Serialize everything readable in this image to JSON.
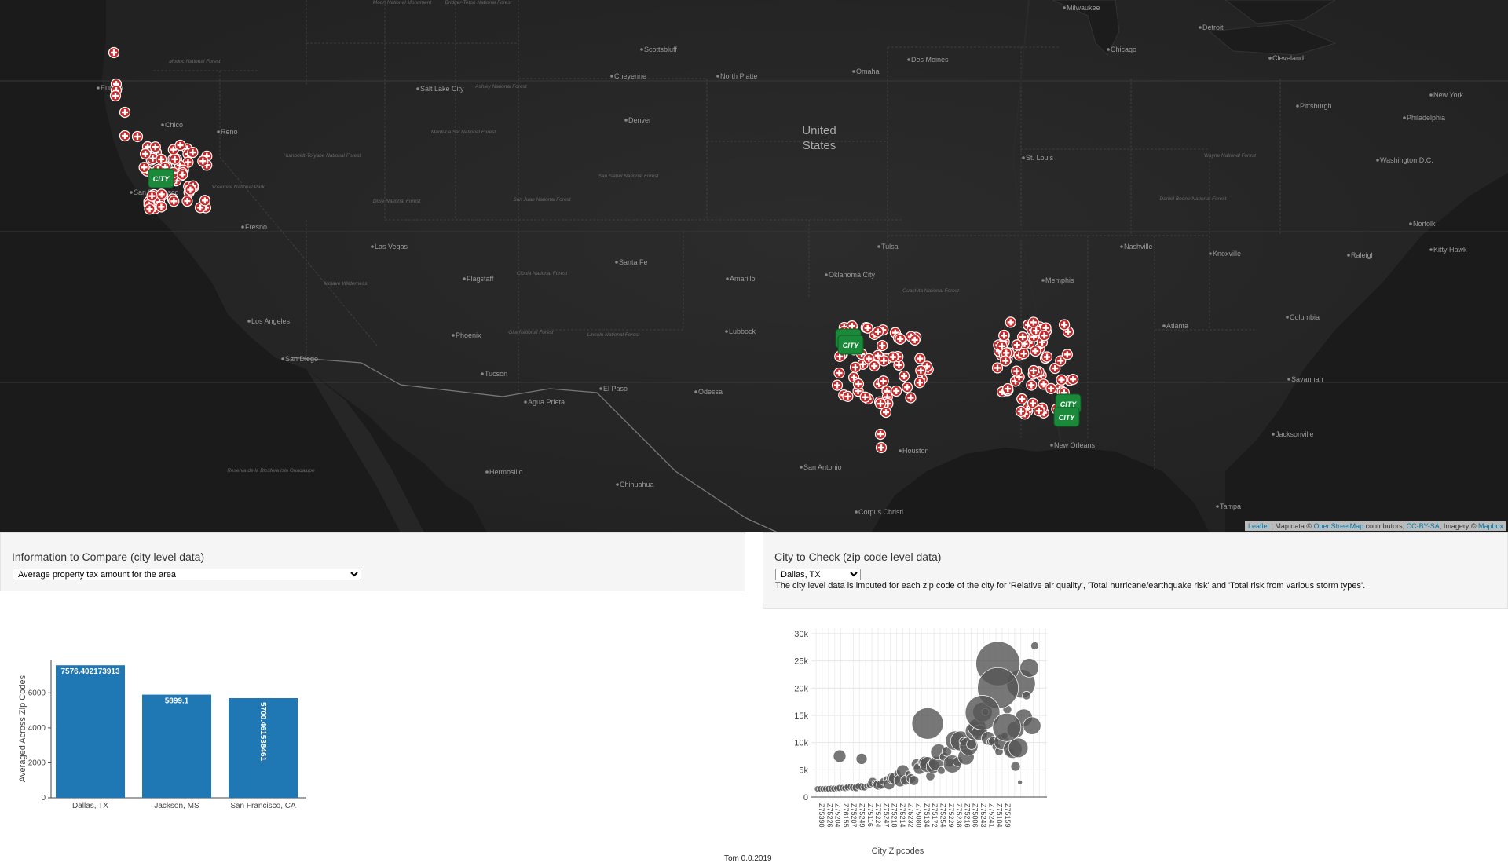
{
  "map": {
    "country_label": [
      "United",
      "States"
    ],
    "cities": [
      {
        "name": "Milwaukee",
        "x": 1358,
        "y": 10
      },
      {
        "name": "Detroit",
        "x": 1531,
        "y": 35
      },
      {
        "name": "Chicago",
        "x": 1414,
        "y": 63
      },
      {
        "name": "Cleveland",
        "x": 1620,
        "y": 74
      },
      {
        "name": "New York",
        "x": 1825,
        "y": 121
      },
      {
        "name": "Scottsbluff",
        "x": 820,
        "y": 63
      },
      {
        "name": "Cheyenne",
        "x": 782,
        "y": 97
      },
      {
        "name": "North Platte",
        "x": 917,
        "y": 97
      },
      {
        "name": "Omaha",
        "x": 1090,
        "y": 91
      },
      {
        "name": "Des Moines",
        "x": 1160,
        "y": 76
      },
      {
        "name": "Pittsburgh",
        "x": 1655,
        "y": 135
      },
      {
        "name": "Philadelphia",
        "x": 1791,
        "y": 150
      },
      {
        "name": "Washington D.C.",
        "x": 1757,
        "y": 204
      },
      {
        "name": "Norfolk",
        "x": 1799,
        "y": 285
      },
      {
        "name": "Eureka",
        "x": 128,
        "y": 112
      },
      {
        "name": "Salt Lake City",
        "x": 535,
        "y": 113
      },
      {
        "name": "Denver",
        "x": 800,
        "y": 153
      },
      {
        "name": "Chico",
        "x": 210,
        "y": 159
      },
      {
        "name": "Reno",
        "x": 281,
        "y": 168
      },
      {
        "name": "San Francisco",
        "x": 170,
        "y": 245
      },
      {
        "name": "Fresno",
        "x": 312,
        "y": 289
      },
      {
        "name": "Las Vegas",
        "x": 477,
        "y": 314
      },
      {
        "name": "Flagstaff",
        "x": 594,
        "y": 355
      },
      {
        "name": "Santa Fe",
        "x": 788,
        "y": 334
      },
      {
        "name": "Amarillo",
        "x": 929,
        "y": 355
      },
      {
        "name": "Oklahoma City",
        "x": 1055,
        "y": 350
      },
      {
        "name": "Tulsa",
        "x": 1122,
        "y": 314
      },
      {
        "name": "Memphis",
        "x": 1331,
        "y": 357
      },
      {
        "name": "Nashville",
        "x": 1431,
        "y": 314
      },
      {
        "name": "Knoxville",
        "x": 1544,
        "y": 323
      },
      {
        "name": "Raleigh",
        "x": 1720,
        "y": 325
      },
      {
        "name": "Kitty Hawk",
        "x": 1825,
        "y": 318
      },
      {
        "name": "St. Louis",
        "x": 1306,
        "y": 201
      },
      {
        "name": "Los Angeles",
        "x": 320,
        "y": 409
      },
      {
        "name": "Phoenix",
        "x": 580,
        "y": 427
      },
      {
        "name": "San Diego",
        "x": 363,
        "y": 457
      },
      {
        "name": "Lubbock",
        "x": 928,
        "y": 422
      },
      {
        "name": "Tucson",
        "x": 617,
        "y": 476
      },
      {
        "name": "El Paso",
        "x": 768,
        "y": 495
      },
      {
        "name": "Odessa",
        "x": 889,
        "y": 499
      },
      {
        "name": "Agua Prieta",
        "x": 672,
        "y": 512
      },
      {
        "name": "Columbia",
        "x": 1642,
        "y": 404
      },
      {
        "name": "Atlanta",
        "x": 1485,
        "y": 415
      },
      {
        "name": "Savannah",
        "x": 1644,
        "y": 483
      },
      {
        "name": "Jacksonville",
        "x": 1624,
        "y": 553
      },
      {
        "name": "Houston",
        "x": 1149,
        "y": 574
      },
      {
        "name": "New Orleans",
        "x": 1342,
        "y": 567
      },
      {
        "name": "San Antonio",
        "x": 1023,
        "y": 595
      },
      {
        "name": "Hermosillo",
        "x": 623,
        "y": 601
      },
      {
        "name": "Chihuahua",
        "x": 789,
        "y": 617
      },
      {
        "name": "Corpus Christi",
        "x": 1093,
        "y": 652
      },
      {
        "name": "Tampa",
        "x": 1553,
        "y": 645
      }
    ],
    "forests": [
      {
        "name": "Modoc National Forest",
        "x": 248,
        "y": 80
      },
      {
        "name": "Humboldt-Toiyabe National Forest",
        "x": 410,
        "y": 200
      },
      {
        "name": "Ashley National Forest",
        "x": 638,
        "y": 112
      },
      {
        "name": "Manti-La Sal National Forest",
        "x": 590,
        "y": 170
      },
      {
        "name": "Dixie National Forest",
        "x": 505,
        "y": 258
      },
      {
        "name": "San Juan National Forest",
        "x": 690,
        "y": 256
      },
      {
        "name": "San Isabel National Forest",
        "x": 800,
        "y": 226
      },
      {
        "name": "Yosemite National Park",
        "x": 303,
        "y": 240
      },
      {
        "name": "Mojave Wilderness",
        "x": 440,
        "y": 363
      },
      {
        "name": "Cibola National Forest",
        "x": 690,
        "y": 350
      },
      {
        "name": "Gila National Forest",
        "x": 676,
        "y": 425
      },
      {
        "name": "Lincoln National Forest",
        "x": 781,
        "y": 428
      },
      {
        "name": "Ouachita National Forest",
        "x": 1185,
        "y": 372
      },
      {
        "name": "Wayne National Forest",
        "x": 1566,
        "y": 200
      },
      {
        "name": "Daniel Boone National Forest",
        "x": 1519,
        "y": 255
      },
      {
        "name": "Moon National Monument",
        "x": 512,
        "y": 5
      },
      {
        "name": "Bridger-Teton National Forest",
        "x": 609,
        "y": 5
      },
      {
        "name": "Reserva de la Biosfera Isla Guadalupe",
        "x": 345,
        "y": 601
      }
    ],
    "attribution": {
      "leaflet": "Leaflet",
      "sep": " | Map data © ",
      "osm": "OpenStreetMap",
      "contrib": " contributors, ",
      "license": "CC-BY-SA",
      "imagery": ", Imagery © ",
      "mapbox": "Mapbox"
    }
  },
  "left_panel": {
    "title": "Information to Compare (city level data)",
    "selected": "Average property tax amount for the area"
  },
  "right_panel": {
    "title": "City to Check (zip code level data)",
    "selected": "Dallas, TX",
    "note": "The city level data is imputed for each zip code of the city for 'Relative air quality', 'Total hurricane/earthquake risk' and 'Total risk from various storm types'."
  },
  "chart_data": [
    {
      "type": "bar",
      "categories": [
        "Dallas, TX",
        "Jackson, MS",
        "San Francisco, CA"
      ],
      "values": [
        7576.402173913,
        5899.1,
        5700.461538461
      ],
      "labels": [
        "7576.402173913",
        "5899.1",
        "5700.461538461"
      ],
      "ylabel": "Averaged Across Zip Codes",
      "ylim": [
        0,
        7900
      ],
      "yticks": [
        0,
        2000,
        4000,
        6000
      ],
      "color": "#1f77b4"
    },
    {
      "type": "scatter",
      "xlabel": "City Zipcodes",
      "ylim": [
        0,
        31000
      ],
      "yticks": [
        0,
        5000,
        10000,
        15000,
        20000,
        25000,
        30000
      ],
      "ytick_labels": [
        "0",
        "5k",
        "10k",
        "15k",
        "20k",
        "25k",
        "30k"
      ],
      "xtick_labels": [
        "Z75390",
        "Z75226",
        "Z75204",
        "Z76155",
        "Z75207",
        "Z75249",
        "Z75116",
        "Z75224",
        "Z75247",
        "Z75218",
        "Z75214",
        "Z75232",
        "Z75080",
        "Z75134",
        "Z75172",
        "Z75254",
        "Z75229",
        "Z75238",
        "Z75216",
        "Z75006",
        "Z75243",
        "Z75241",
        "Z75104",
        "Z75159"
      ],
      "marker_color": "#555555"
    }
  ],
  "footer": "Tom 0.0.2019"
}
